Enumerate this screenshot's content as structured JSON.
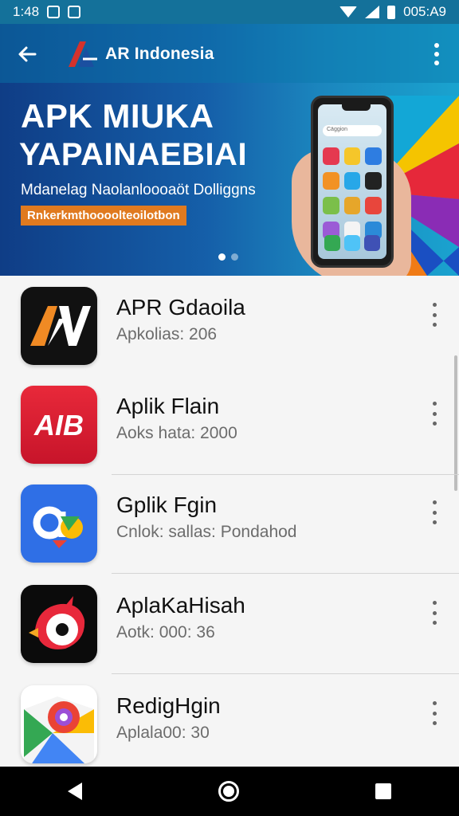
{
  "status_bar": {
    "time": "1:48",
    "clock_right": "005:A9"
  },
  "header": {
    "brand": "AR Indonesia",
    "headline_line1": "APK MIUKA",
    "headline_line2": "YAPAINAEBIAI",
    "subtitle": "Mdanelag Naolanloooaöt Dolliggns",
    "promo_label": "Rnkerkmthoooolteoilotbon",
    "phone_search_hint": "Cäggion",
    "carousel": {
      "total": 2,
      "active": 1
    }
  },
  "apps": [
    {
      "name": "APR Gdaoila",
      "meta": "Apkolias: 206",
      "icon": "av-logo-icon"
    },
    {
      "name": "Aplik Flain",
      "meta": "Aoks hata: 2000",
      "icon": "aib-logo-icon"
    },
    {
      "name": "Gplik Fgin",
      "meta": "Cnlok: sallas: Pondahod",
      "icon": "gb-logo-icon"
    },
    {
      "name": "AplaKaHisah",
      "meta": "Aotk: 000: 36",
      "icon": "bird-logo-icon"
    },
    {
      "name": "RedigHgin",
      "meta": "Aplala00: 30",
      "icon": "maps-logo-icon"
    }
  ],
  "icons": {
    "back": "back-arrow-icon",
    "more": "more-vertical-icon",
    "nav_back": "nav-back-icon",
    "nav_home": "nav-home-icon",
    "nav_recent": "nav-recent-icon"
  },
  "colors": {
    "status_bar": "#14719a",
    "banner_dark": "#0f3d86",
    "banner_light": "#1aa3cf",
    "promo": "#e07a1f",
    "background": "#f5f5f5"
  }
}
